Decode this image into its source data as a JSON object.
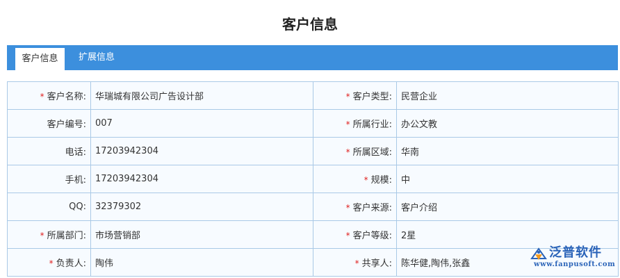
{
  "page": {
    "title": "客户信息"
  },
  "tabs": [
    {
      "label": "客户信息",
      "active": true
    },
    {
      "label": "扩展信息",
      "active": false
    }
  ],
  "required_mark": "*",
  "rows": [
    {
      "left": {
        "label": "客户名称:",
        "value": "华瑞城有限公司广告设计部",
        "required": true
      },
      "right": {
        "label": "客户类型:",
        "value": "民营企业",
        "required": true
      }
    },
    {
      "left": {
        "label": "客户编号:",
        "value": "007",
        "required": false
      },
      "right": {
        "label": "所属行业:",
        "value": "办公文教",
        "required": true
      }
    },
    {
      "left": {
        "label": "电话:",
        "value": "17203942304",
        "required": false
      },
      "right": {
        "label": "所属区域:",
        "value": "华南",
        "required": true
      }
    },
    {
      "left": {
        "label": "手机:",
        "value": "17203942304",
        "required": false
      },
      "right": {
        "label": "规模:",
        "value": "中",
        "required": true
      }
    },
    {
      "left": {
        "label": "QQ:",
        "value": "32379302",
        "required": false
      },
      "right": {
        "label": "客户来源:",
        "value": "客户介绍",
        "required": true
      }
    },
    {
      "left": {
        "label": "所属部门:",
        "value": "市场营销部",
        "required": true
      },
      "right": {
        "label": "客户等级:",
        "value": "2星",
        "required": true
      }
    },
    {
      "left": {
        "label": "负责人:",
        "value": "陶伟",
        "required": true
      },
      "right": {
        "label": "共享人:",
        "value": "陈华健,陶伟,张鑫",
        "required": true
      }
    }
  ],
  "logo": {
    "name": "泛普软件",
    "url": "www.fanpusoft.com",
    "color": "#2a63b8"
  },
  "colors": {
    "tab_bar": "#3c8fdd",
    "border": "#a9c9e6",
    "required": "#e02020"
  }
}
